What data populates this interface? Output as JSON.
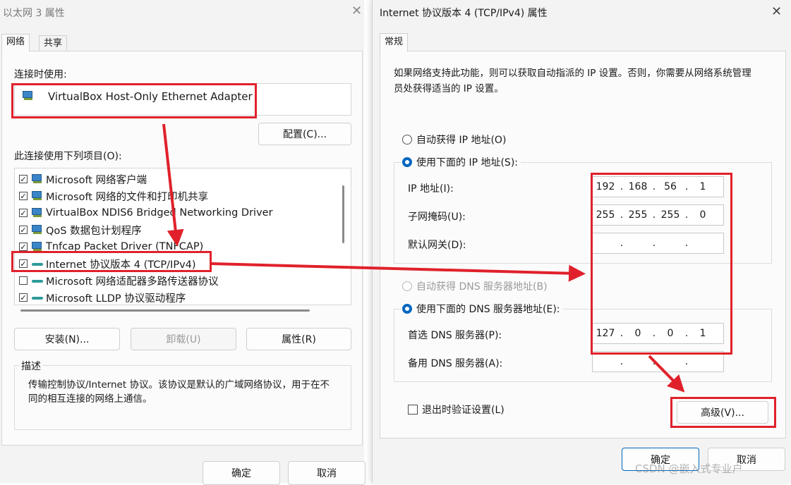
{
  "left": {
    "title": "以太网 3 属性",
    "tabs": [
      "网络",
      "共享"
    ],
    "connect_using_label": "连接时使用:",
    "adapter_name": "VirtualBox Host-Only Ethernet Adapter",
    "configure_button": "配置(C)...",
    "items_label": "此连接使用下列项目(O):",
    "items": [
      {
        "label": "Microsoft 网络客户端",
        "checked": true,
        "icon": "network-icon"
      },
      {
        "label": "Microsoft 网络的文件和打印机共享",
        "checked": true,
        "icon": "network-icon"
      },
      {
        "label": "VirtualBox NDIS6 Bridged Networking Driver",
        "checked": true,
        "icon": "network-icon"
      },
      {
        "label": "QoS 数据包计划程序",
        "checked": true,
        "icon": "network-icon"
      },
      {
        "label": "Tnfcap Packet Driver (TNFCAP)",
        "checked": true,
        "icon": "network-icon"
      },
      {
        "label": "Internet 协议版本 4 (TCP/IPv4)",
        "checked": true,
        "icon": "protocol-icon"
      },
      {
        "label": "Microsoft 网络适配器多路传送器协议",
        "checked": false,
        "icon": "protocol-icon"
      },
      {
        "label": "Microsoft LLDP 协议驱动程序",
        "checked": true,
        "icon": "protocol-icon"
      }
    ],
    "install_button": "安装(N)...",
    "uninstall_button": "卸载(U)",
    "properties_button": "属性(R)",
    "description_title": "描述",
    "description_text": "传输控制协议/Internet 协议。该协议是默认的广域网络协议，用于在不同的相互连接的网络上通信。",
    "ok_button": "确定",
    "cancel_button": "取消"
  },
  "right": {
    "title": "Internet 协议版本 4 (TCP/IPv4) 属性",
    "tab": "常规",
    "intro": "如果网络支持此功能，则可以获取自动指派的 IP 设置。否则，你需要从网络系统管理员处获得适当的 IP 设置。",
    "auto_ip": "自动获得 IP 地址(O)",
    "manual_ip": "使用下面的 IP 地址(S):",
    "ip_label": "IP 地址(I):",
    "ip_value": [
      "192",
      "168",
      "56",
      "1"
    ],
    "mask_label": "子网掩码(U):",
    "mask_value": [
      "255",
      "255",
      "255",
      "0"
    ],
    "gateway_label": "默认网关(D):",
    "gateway_value": [
      "",
      "",
      "",
      ""
    ],
    "auto_dns": "自动获得 DNS 服务器地址(B)",
    "manual_dns": "使用下面的 DNS 服务器地址(E):",
    "pref_dns_label": "首选 DNS 服务器(P):",
    "pref_dns_value": [
      "127",
      "0",
      "0",
      "1"
    ],
    "alt_dns_label": "备用 DNS 服务器(A):",
    "alt_dns_value": [
      "",
      "",
      "",
      ""
    ],
    "validate_label": "退出时验证设置(L)",
    "advanced_button": "高级(V)...",
    "ok_button": "确定",
    "cancel_button": "取消"
  },
  "watermark": "CSDN @嵌入式专业户",
  "colors": {
    "highlight": "#e0212b",
    "accent": "#0067c0"
  }
}
